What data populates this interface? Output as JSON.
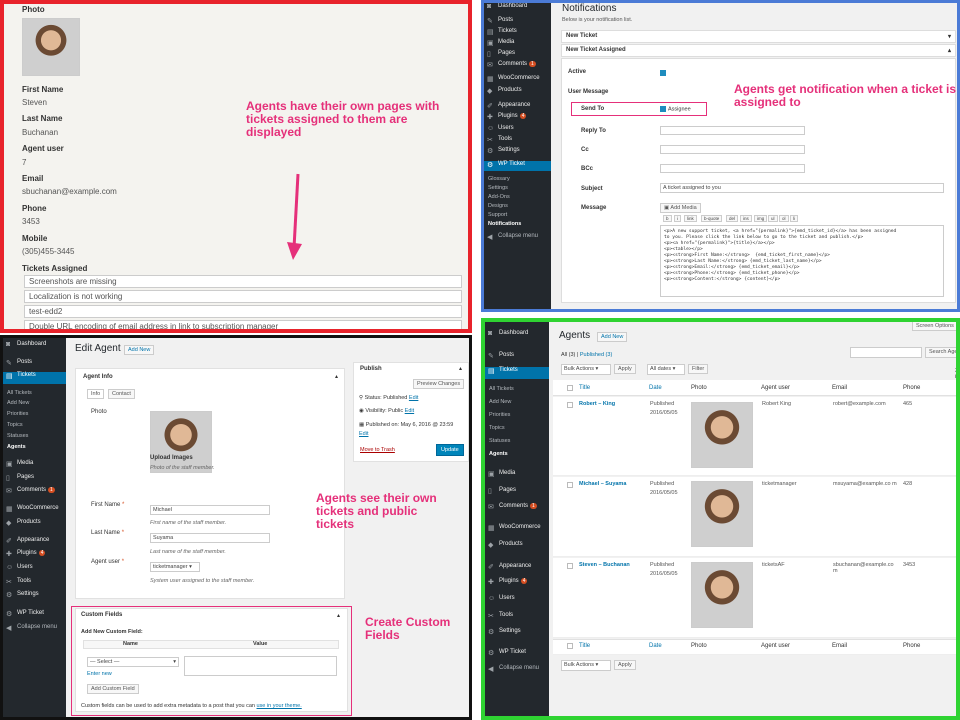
{
  "colors": {
    "red": "#e8232b",
    "blue": "#4b7bd6",
    "black": "#111111",
    "green": "#2fd332",
    "accent": "#e5307a",
    "wp_blue": "#0073aa",
    "sidebar": "#23282d"
  },
  "profile": {
    "photo_label": "Photo",
    "first_name_label": "First Name",
    "first_name": "Steven",
    "last_name_label": "Last Name",
    "last_name": "Buchanan",
    "agent_user_label": "Agent user",
    "agent_user": "7",
    "email_label": "Email",
    "email": "sbuchanan@example.com",
    "phone_label": "Phone",
    "phone": "3453",
    "mobile_label": "Mobile",
    "mobile": "(305)455-3445",
    "tickets_label": "Tickets Assigned",
    "tickets": [
      "Screenshots are missing",
      "Localization is not working",
      "test-edd2",
      "Double URL encoding of email address in link to subscription manager"
    ],
    "annotation": "Agents have their own pages with tickets assigned to them are displayed"
  },
  "notif": {
    "sidebar": [
      "Dashboard",
      "Posts",
      "Tickets",
      "Media",
      "Pages",
      "Comments",
      "WooCommerce",
      "Products",
      "Appearance",
      "Plugins",
      "Users",
      "Tools",
      "Settings",
      "WP Ticket"
    ],
    "comments_badge": "1",
    "plugins_badge": "4",
    "submenu": [
      "Glossary",
      "Settings",
      "Add-Ons",
      "Designs",
      "Support",
      "Notifications"
    ],
    "collapse": "Collapse menu",
    "title": "Notifications",
    "subtitle": "Below is your notification list.",
    "bar1": "New Ticket",
    "bar2": "New Ticket Assigned",
    "active": "Active",
    "user_message": "User Message",
    "send_to": "Send To",
    "send_to_val": "Assignee",
    "reply_to": "Reply To",
    "cc": "Cc",
    "bcc": "BCc",
    "subject": "Subject",
    "subject_val": "A ticket assigned to you",
    "message": "Message",
    "add_media": "Add Media",
    "toolbar": [
      "b",
      "i",
      "link",
      "b-quote",
      "del",
      "ins",
      "img",
      "ul",
      "ol",
      "li"
    ],
    "code": [
      "<p>A new support ticket, <a href=\"{permalink}\">{emd_ticket_id}</a> has been assigned",
      "to you. Please click the link below to go to the ticket and publish.</p>",
      "<p><a href=\"{permalink}\">{title}</a></p>",
      "<p><table></p>",
      "<p><strong>First Name:</strong>  {emd_ticket_first_name}</p>",
      "<p><strong>Last Name:</strong> {emd_ticket_last_name}</p>",
      "<p><strong>Email:</strong> {emd_ticket_email}</p>",
      "<p><strong>Phone:</strong> {emd_ticket_phone}</p>",
      "<p><strong>Content:</strong> {content}</p>"
    ],
    "annotation": "Agents get notification when a ticket is assigned to"
  },
  "edit": {
    "sidebar": [
      "Dashboard",
      "Posts",
      "Tickets",
      "Media",
      "Pages",
      "Comments",
      "WooCommerce",
      "Products",
      "Appearance",
      "Plugins",
      "Users",
      "Tools",
      "Settings",
      "WP Ticket"
    ],
    "submenu": [
      "All Tickets",
      "Add New",
      "Priorities",
      "Topics",
      "Statuses",
      "Agents"
    ],
    "comments_badge": "1",
    "plugins_badge": "4",
    "collapse": "Collapse menu",
    "title": "Edit Agent",
    "add_new": "Add New",
    "box_title": "Agent Info",
    "tab_info": "Info",
    "tab_contact": "Contact",
    "photo": "Photo",
    "upload": "Upload Images",
    "photo_help": "Photo of the staff member.",
    "first_name": "First Name",
    "first_val": "Michael",
    "first_help": "First name of the staff member.",
    "last_name": "Last Name",
    "last_val": "Suyama",
    "last_help": "Last name of the staff member.",
    "agent_user": "Agent user",
    "agent_val": "ticketmanager",
    "agent_help": "System user assigned to the staff member.",
    "publish": "Publish",
    "preview": "Preview Changes",
    "status": "Status: Published",
    "visibility": "Visibility: Public",
    "published_on": "Published on: May 6, 2016 @ 23:59",
    "edit": "Edit",
    "trash": "Move to Trash",
    "update": "Update",
    "cf_title": "Custom Fields",
    "cf_add": "Add New Custom Field:",
    "cf_name": "Name",
    "cf_value": "Value",
    "cf_select": "— Select —",
    "cf_enter": "Enter new",
    "cf_btn": "Add Custom Field",
    "cf_help": "Custom fields can be used to add extra metadata to a post that you can",
    "cf_help_link": "use in your theme.",
    "ann1": "Agents see their own tickets and public tickets",
    "ann2": "Create Custom Fields"
  },
  "agents": {
    "sidebar": [
      "Dashboard",
      "Posts",
      "Tickets",
      "Media",
      "Pages",
      "Comments",
      "WooCommerce",
      "Products",
      "Appearance",
      "Plugins",
      "Users",
      "Tools",
      "Settings",
      "WP Ticket"
    ],
    "submenu": [
      "All Tickets",
      "Add New",
      "Priorities",
      "Topics",
      "Statuses",
      "Agents"
    ],
    "comments_badge": "1",
    "plugins_badge": "4",
    "collapse": "Collapse menu",
    "title": "Agents",
    "add_new": "Add New",
    "screen_options": "Screen Options",
    "search_btn": "Search Agen",
    "all": "All (3)",
    "published": "Published (3)",
    "bulk": "Bulk Actions",
    "apply": "Apply",
    "dates": "All dates",
    "filter": "Filter",
    "count": "3 it",
    "cols": [
      "Title",
      "Date",
      "Photo",
      "Agent user",
      "Email",
      "Phone"
    ],
    "rows": [
      {
        "title": "Robert – King",
        "status": "Published",
        "date": "2016/05/05",
        "user": "Robert King",
        "email": "robert@example.com",
        "phone": "465"
      },
      {
        "title": "Michael – Suyama",
        "status": "Published",
        "date": "2016/05/05",
        "user": "ticketmanager",
        "email": "msuyama@example.co m",
        "phone": "428"
      },
      {
        "title": "Steven – Buchanan",
        "status": "Published",
        "date": "2016/05/05",
        "user": "ticketsAF",
        "email": "sbuchanan@example.co m",
        "phone": "3453"
      }
    ]
  }
}
